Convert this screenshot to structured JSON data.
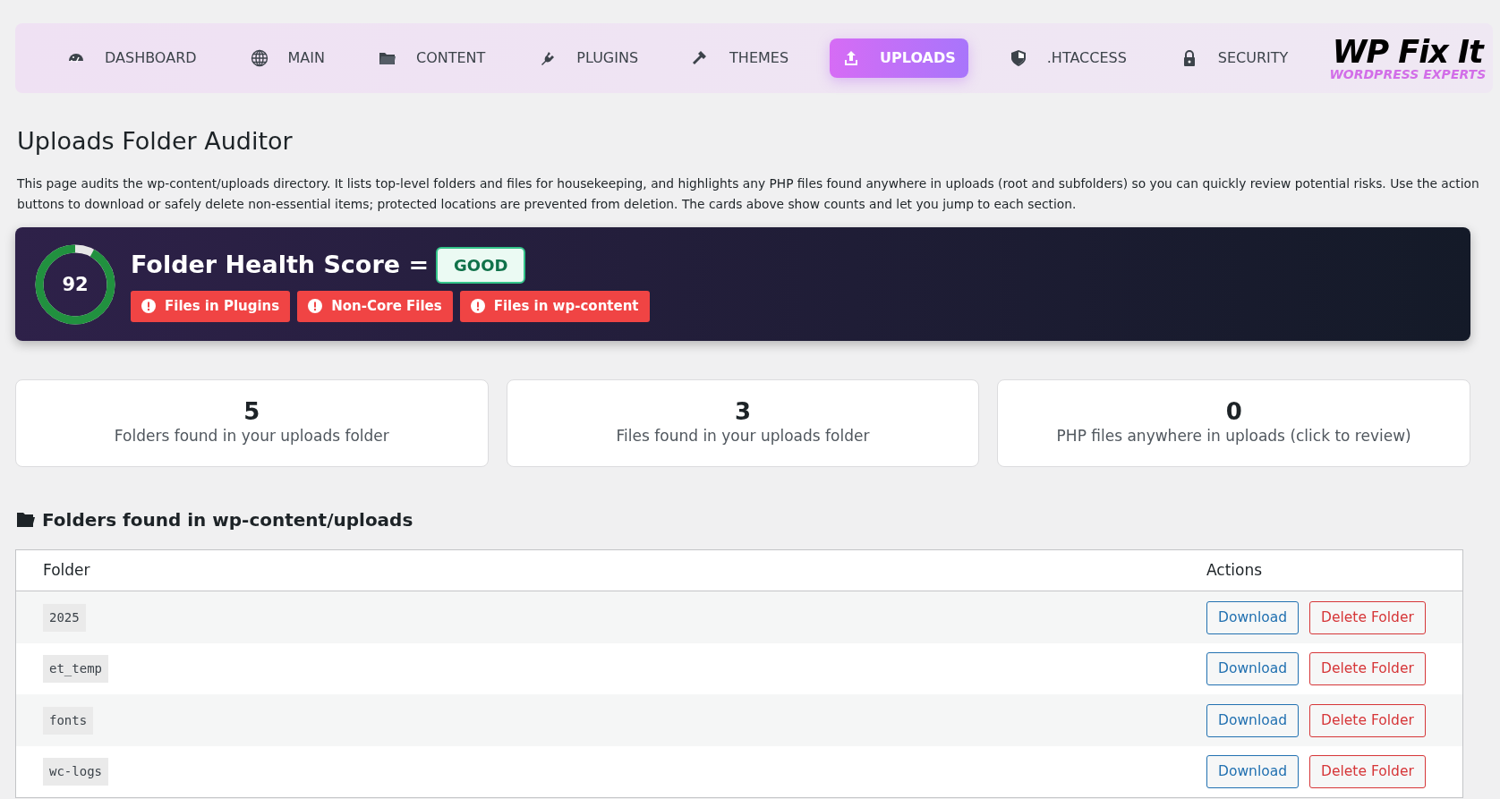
{
  "nav": {
    "items": [
      {
        "label": "DASHBOARD",
        "selected": false
      },
      {
        "label": "MAIN",
        "selected": false
      },
      {
        "label": "CONTENT",
        "selected": false
      },
      {
        "label": "PLUGINS",
        "selected": false
      },
      {
        "label": "THEMES",
        "selected": false
      },
      {
        "label": "UPLOADS",
        "selected": true
      },
      {
        "label": ".HTACCESS",
        "selected": false
      },
      {
        "label": "SECURITY",
        "selected": false
      }
    ],
    "logo": {
      "title": "WP Fix It",
      "subtitle": "WORDPRESS EXPERTS"
    }
  },
  "page": {
    "title": "Uploads Folder Auditor",
    "description": "This page audits the wp-content/uploads directory. It lists top-level folders and files for housekeeping, and highlights any PHP files found anywhere in uploads (root and subfolders) so you can quickly review potential risks. Use the action buttons to download or safely delete non-essential items; protected locations are prevented from deletion. The cards above show counts and let you jump to each section."
  },
  "health": {
    "score": "92",
    "level": 0.92,
    "title": "Folder Health Score =",
    "rating": "GOOD",
    "alerts": [
      "Files in Plugins",
      "Non-Core Files",
      "Files in wp-content"
    ]
  },
  "stats": [
    {
      "count": "5",
      "label": "Folders found in your uploads folder"
    },
    {
      "count": "3",
      "label": "Files found in your uploads folder"
    },
    {
      "count": "0",
      "label": "PHP files anywhere in uploads (click to review)"
    }
  ],
  "folders": {
    "heading": "Folders found in wp-content/uploads",
    "columns": [
      "Folder",
      "Actions"
    ],
    "rows": [
      {
        "name": "2025",
        "actions": [
          "Download",
          "Delete Folder"
        ]
      },
      {
        "name": "et_temp",
        "actions": [
          "Download",
          "Delete Folder"
        ]
      },
      {
        "name": "fonts",
        "actions": [
          "Download",
          "Delete Folder"
        ]
      },
      {
        "name": "wc-logs",
        "actions": [
          "Download",
          "Delete Folder"
        ]
      }
    ]
  }
}
